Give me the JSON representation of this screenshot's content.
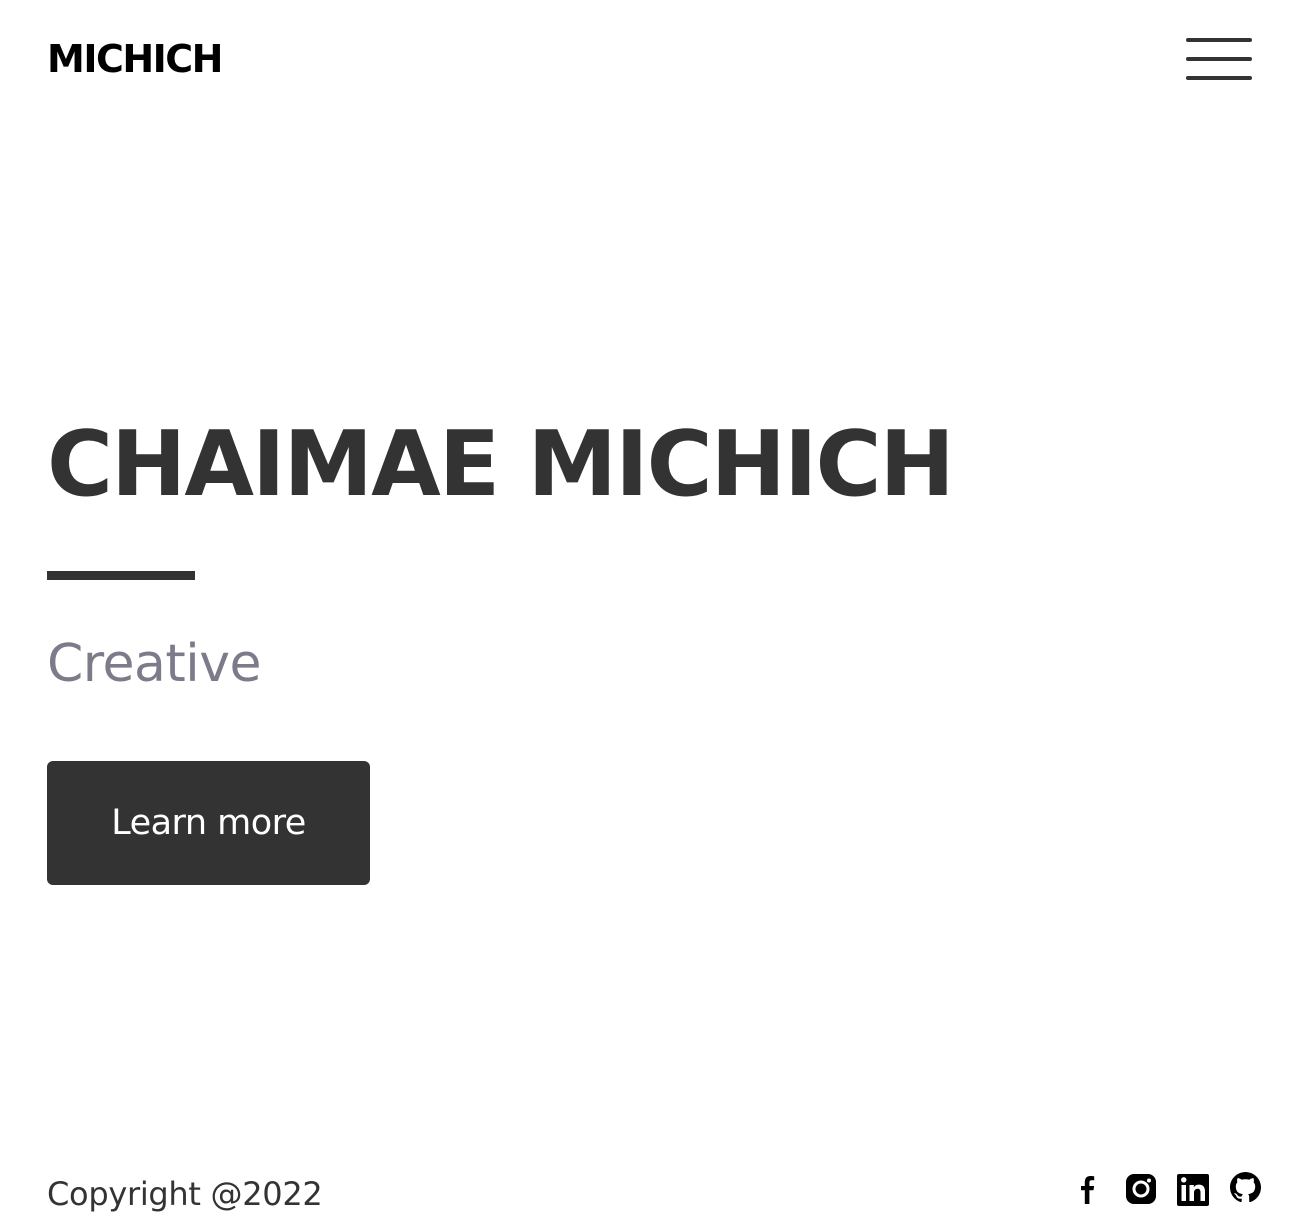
{
  "header": {
    "logo": "MICHICH",
    "menu_icon": "hamburger-menu-icon"
  },
  "hero": {
    "title": "CHAIMAE MICHICH",
    "subtitle": "Creative",
    "button_label": "Learn more"
  },
  "footer": {
    "copyright": "Copyright @2022",
    "socials": [
      {
        "icon": "facebook-icon"
      },
      {
        "icon": "instagram-icon"
      },
      {
        "icon": "linkedin-icon"
      },
      {
        "icon": "github-icon"
      }
    ]
  },
  "colors": {
    "background": "#ffffff",
    "primary_dark": "#333333",
    "subtitle_gray": "#7b7b8a",
    "button_text": "#ffffff"
  }
}
